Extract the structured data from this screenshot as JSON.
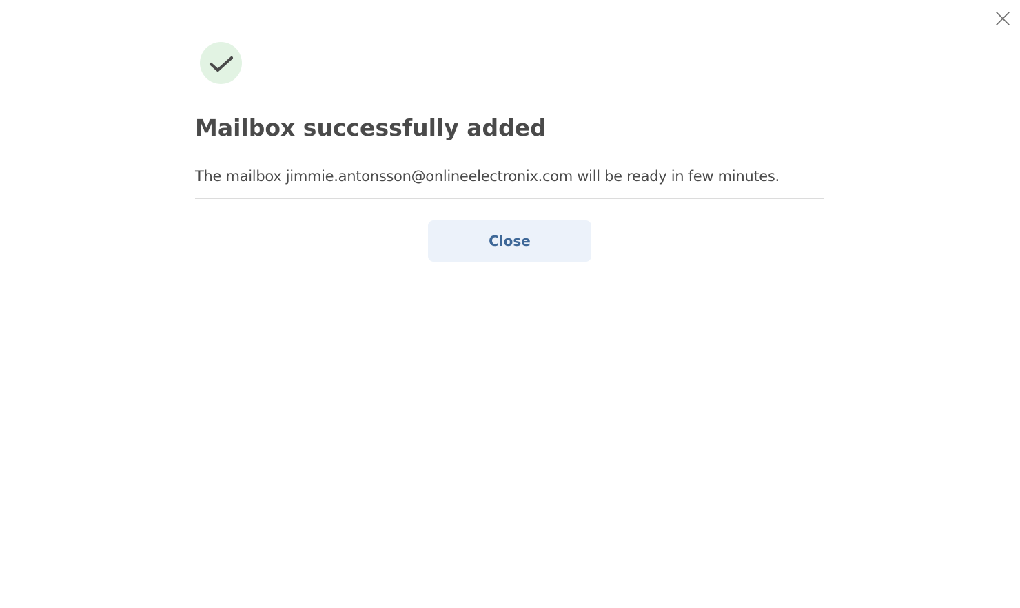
{
  "dialog": {
    "title": "Mailbox successfully added",
    "message": "The mailbox jimmie.antonsson@onlineelectronix.com will be ready in few minutes.",
    "close_button_label": "Close"
  },
  "icons": {
    "success": "check-icon",
    "dismiss": "close-icon"
  },
  "colors": {
    "success_badge_bg": "#e2f3e3",
    "button_bg": "#ecf2fa",
    "button_text": "#3e6898",
    "text": "#4a4a4a"
  }
}
